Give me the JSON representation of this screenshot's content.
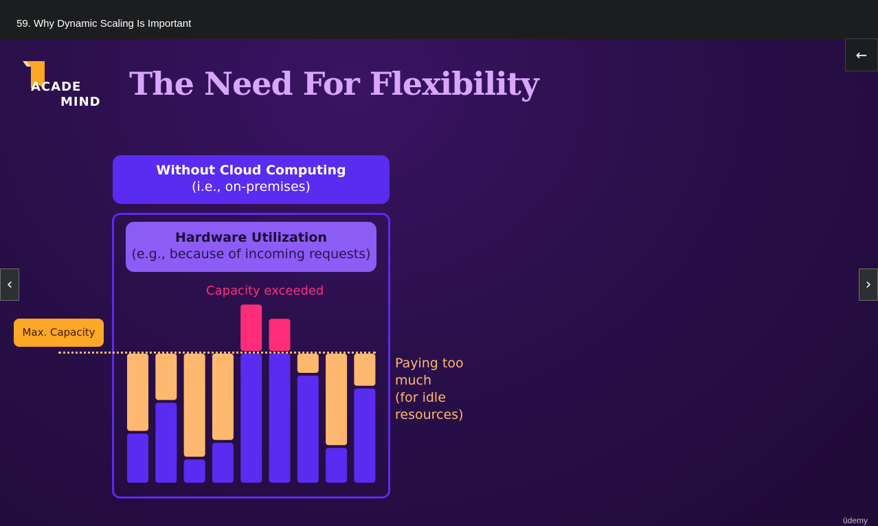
{
  "header": {
    "lecture_title": "59. Why Dynamic Scaling Is Important"
  },
  "slide": {
    "logo": {
      "line1": "ACADE",
      "line2": "MIND"
    },
    "title": "The Need For Flexibility",
    "top_box": {
      "line1": "Without Cloud Computing",
      "line2": "(i.e., on-premises)"
    },
    "util_box": {
      "line1": "Hardware Utilization",
      "line2": "(e.g., because of incoming requests)"
    },
    "exceeded_label": "Capacity exceeded",
    "max_capacity_label": "Max. Capacity",
    "paying_label": [
      "Paying too",
      "much",
      "(for idle",
      "resources)"
    ],
    "watermark": "ûdemy"
  },
  "chart_data": {
    "type": "bar",
    "description_series": [
      "used",
      "idle",
      "exceeded"
    ],
    "max_capacity": 100,
    "values_used": [
      38,
      62,
      18,
      31,
      100,
      100,
      83,
      27,
      73
    ],
    "values_idle": [
      62,
      38,
      82,
      69,
      0,
      0,
      17,
      73,
      27
    ],
    "values_exceeded": [
      0,
      0,
      0,
      0,
      38,
      27,
      0,
      0,
      0
    ],
    "colors": {
      "used": "#5a2bf0",
      "idle": "#ffb870",
      "exceeded": "#ff2d78"
    }
  },
  "controls": {
    "prev_icon": "‹",
    "next_icon": "›",
    "expand_icon": "←"
  },
  "colors": {
    "background": "#2a0f4a",
    "accent": "#5a2bf0",
    "title": "#d8a6ff"
  }
}
